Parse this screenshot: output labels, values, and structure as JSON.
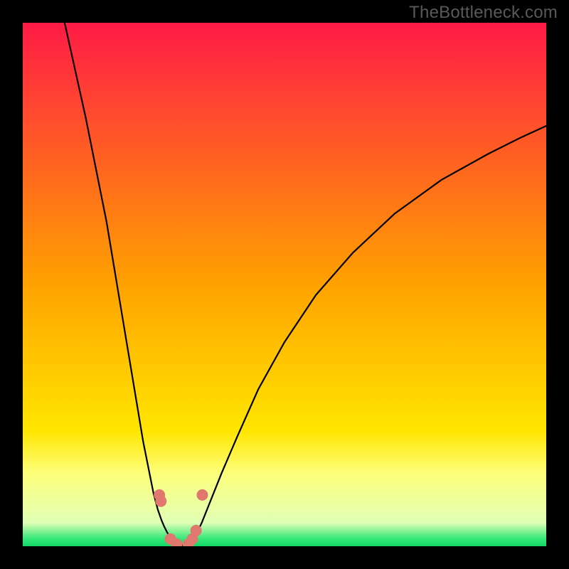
{
  "watermark": "TheBottleneck.com",
  "chart_data": {
    "type": "line",
    "title": "",
    "xlabel": "",
    "ylabel": "",
    "xlim": [
      0,
      100
    ],
    "ylim": [
      0,
      100
    ],
    "grid": false,
    "background_gradient": [
      {
        "offset": 0.0,
        "color": "#ff1b46"
      },
      {
        "offset": 0.5,
        "color": "#ffa200"
      },
      {
        "offset": 0.78,
        "color": "#ffe600"
      },
      {
        "offset": 0.86,
        "color": "#fdff7a"
      },
      {
        "offset": 0.955,
        "color": "#e0ffb5"
      },
      {
        "offset": 0.985,
        "color": "#37e87a"
      },
      {
        "offset": 1.0,
        "color": "#11d867"
      }
    ],
    "series": [
      {
        "name": "left-branch",
        "color": "#000000",
        "x": [
          8,
          12,
          16,
          18,
          20,
          21.5,
          23,
          24,
          25,
          25.8,
          26.5,
          27,
          27.5,
          28.2,
          28.8
        ],
        "y": [
          100,
          82,
          62,
          50,
          38,
          29,
          20,
          15,
          10,
          7,
          5,
          3.8,
          2.8,
          1.6,
          0.8
        ]
      },
      {
        "name": "right-branch",
        "color": "#000000",
        "x": [
          32.2,
          33,
          34.2,
          36,
          38,
          41,
          45,
          50,
          56,
          63,
          71,
          80,
          89,
          95,
          100
        ],
        "y": [
          0.8,
          2,
          4.5,
          9,
          14,
          21,
          30,
          39,
          48,
          56,
          63.5,
          70,
          75,
          78,
          80.3
        ]
      },
      {
        "name": "valley-floor",
        "color": "#000000",
        "x": [
          28.8,
          29.3,
          30,
          30.8,
          31.5,
          32.2
        ],
        "y": [
          0.8,
          0.35,
          0.2,
          0.2,
          0.35,
          0.8
        ]
      }
    ],
    "markers": {
      "name": "highlight-points",
      "color": "#e0786f",
      "radius": 8,
      "points": [
        {
          "x": 26.1,
          "y": 9.8
        },
        {
          "x": 26.4,
          "y": 8.6
        },
        {
          "x": 28.2,
          "y": 1.4
        },
        {
          "x": 29.4,
          "y": 0.4
        },
        {
          "x": 31.6,
          "y": 0.4
        },
        {
          "x": 32.4,
          "y": 1.4
        },
        {
          "x": 33.1,
          "y": 3.0
        },
        {
          "x": 34.3,
          "y": 9.8
        }
      ]
    }
  }
}
